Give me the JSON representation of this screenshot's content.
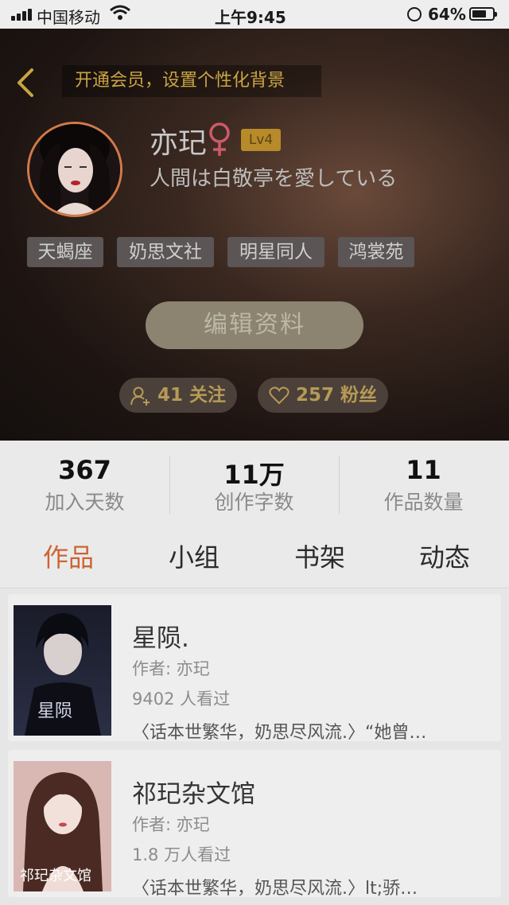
{
  "status_bar": {
    "carrier": "中国移动",
    "time": "上午9:45",
    "battery": "64%"
  },
  "header": {
    "vip_banner": "开通会员，设置个性化背景",
    "username": "亦玘",
    "level": "Lv4",
    "bio": "人間は白敬亭を愛している",
    "tags": [
      "天蝎座",
      "奶思文社",
      "明星同人",
      "鸿裳苑"
    ],
    "edit_label": "编辑资料",
    "following": "41 关注",
    "fans": "257 粉丝"
  },
  "stats": [
    {
      "value": "367",
      "label": "加入天数"
    },
    {
      "value": "11万",
      "label": "创作字数"
    },
    {
      "value": "11",
      "label": "作品数量"
    }
  ],
  "tabs": [
    "作品",
    "小组",
    "书架",
    "动态"
  ],
  "works": [
    {
      "title": "星陨.",
      "author": "作者: 亦玘",
      "views": "9402 人看过",
      "desc": "〈话本世繁华，奶思尽风流.〉“她曾…",
      "cover_text": "星陨"
    },
    {
      "title": "祁玘杂文馆",
      "author": "作者: 亦玘",
      "views": "1.8 万人看过",
      "desc": "〈话本世繁华，奶思尽风流.〉lt;骄…",
      "cover_text": "祁玘杂文馆"
    }
  ],
  "colors": {
    "accent": "#cc6436",
    "gold": "#c9a542"
  }
}
